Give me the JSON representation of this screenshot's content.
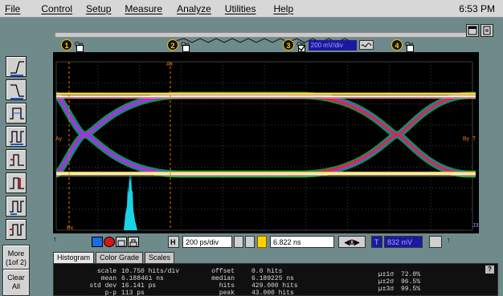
{
  "menu": [
    "File",
    "Control",
    "Setup",
    "Measure",
    "Analyze",
    "Utilities",
    "Help"
  ],
  "clock": "6:53 PM",
  "channels": [
    {
      "num": "1",
      "on_label": "On",
      "checked": false
    },
    {
      "num": "2",
      "on_label": "On",
      "checked": false
    },
    {
      "num": "3",
      "on_label": "On",
      "checked": true,
      "scale": "200 mV/div"
    },
    {
      "num": "4",
      "on_label": "On",
      "checked": false
    }
  ],
  "side_buttons": [
    {
      "name": "more-button",
      "label": "More (1of 2)"
    },
    {
      "name": "clear-all-button",
      "label": "Clear All"
    }
  ],
  "markers": {
    "ax": "Ax",
    "ay": "Ay",
    "bx": "Bx",
    "by": "By",
    "t": "T",
    "j": "J3"
  },
  "controls": {
    "h_label": "H",
    "timebase": "200 ps/div",
    "position": "6.822 ns",
    "nav": "0",
    "t_label": "T",
    "trigger_level": "832 mV"
  },
  "tabs": [
    "Histogram",
    "Color Grade",
    "Scales"
  ],
  "stats": {
    "col1": {
      "labels": [
        "scale",
        "mean",
        "std dev",
        "p-p"
      ],
      "values": [
        "10.750 hits/div",
        "6.188461 ns",
        "16.141 ps",
        "113 ps"
      ]
    },
    "col2": {
      "labels": [
        "offset",
        "median",
        "hits",
        "peak"
      ],
      "values": [
        "0.0 hits",
        "6.189225 ns",
        "429.000 hits",
        "43.000 hits"
      ]
    },
    "col3": {
      "labels": [
        "µ±1σ",
        "µ±2σ",
        "µ±3σ"
      ],
      "values": [
        "72.0%",
        "96.5%",
        "99.5%"
      ]
    }
  },
  "colors": {
    "background": "#6f8a8a",
    "graticule": "#000000",
    "trace_yellow": "#ffd84a",
    "histogram": "#19d5e6",
    "marker_orange": "#e07a10"
  }
}
